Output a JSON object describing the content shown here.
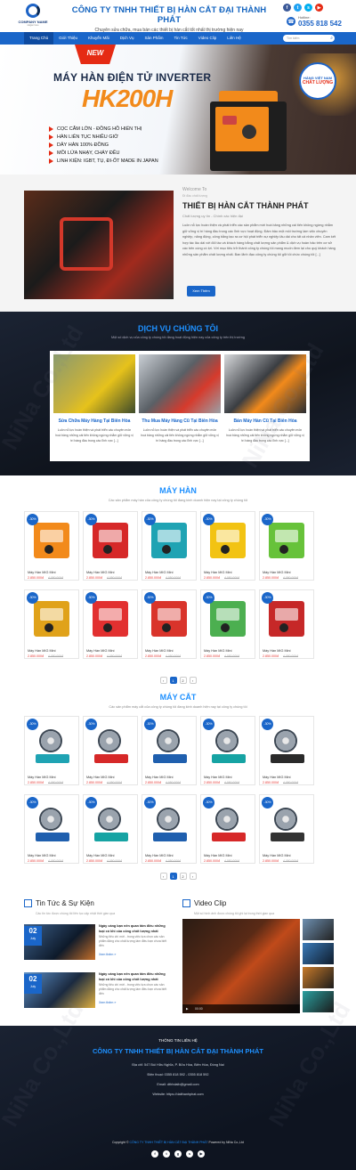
{
  "header": {
    "logo_name": "COMPANY NAME",
    "logo_slogan": "slogan here",
    "company_name": "CÔNG TY TNHH THIẾT BỊ HÀN CẮT ĐẠI THÀNH PHÁT",
    "tagline": "Chuyên sửa chữa, mua bán các thiết bị hàn cắt tốt nhất thị trường hiện nay",
    "socials": [
      {
        "name": "facebook-icon",
        "glyph": "f",
        "color": "#3b5998"
      },
      {
        "name": "twitter-icon",
        "glyph": "t",
        "color": "#1da1f2"
      },
      {
        "name": "skype-icon",
        "glyph": "s",
        "color": "#00aff0"
      },
      {
        "name": "youtube-icon",
        "glyph": "▶",
        "color": "#e52b14"
      }
    ],
    "hotline_label": "Hotline:",
    "hotline": "0355 818 542"
  },
  "nav": {
    "items": [
      "Trang Chủ",
      "Giới Thiệu",
      "Khuyến Mãi",
      "Dịch Vụ",
      "Sản Phẩm",
      "Tin Tức",
      "Video Clip",
      "Liên Hệ"
    ],
    "search_placeholder": "Tìm kiếm"
  },
  "banner": {
    "badge": "NEW",
    "title": "MÁY HÀN ĐIỆN TỬ INVERTER",
    "model": "HK200H",
    "features": [
      "CỌC CẮM LỚN - ĐỒNG HỒ HIỂN THỊ",
      "HÀN LIÊN TỤC NHIỀU GIỜ",
      "DÂY HÀN 100% ĐỒNG",
      "MỒI LỬA NHẠY, CHÁY ĐỀU",
      "LINH KIỆN: IGBT, TỤ, ĐI-ỐT MADE IN JAPAN"
    ],
    "stamp_top": "HÀNG VIỆT NAM",
    "stamp_bottom": "CHẤT LƯỢNG"
  },
  "welcome": {
    "pre": "Welcome To",
    "pre2": "Đi đầu chất lượng",
    "title": "THIẾT BỊ HÀN CẮT THÀNH PHÁT",
    "subtitle": "Chất lượng uy tín - Chính xác hiện đại",
    "paragraph": "Luôn nỗ lực hoàn thiện và phát triển các sản phẩm mới hoá bảng những cái tiến không ngừng nhằm giữ vững vị trí hàng đầu trong các lĩnh vực hoạt động. Đảm bảo một môi trường làm việc chuyên nghiệp, năng động, công bằng tạo ra cơ hội phát triển sự nghiệp lâu dài cho tất cả nhân viên. Cam kết hợp tác lâu dài với đối tác và khách hàng bằng chất lượng sản phẩm & dịch vụ hoàn hảo trên cơ sở các bên cùng có lợi. Với mục tiêu trở thành công ty chúng tôi mang muốn đem lại cho quý khách hàng những sản phẩm chất lượng nhất. Ban lãnh đạo công ty chúng tôi giữ tôi chức chúng tôi [...]",
    "button": "Xem Thêm"
  },
  "services": {
    "title": "DỊCH VỤ CHÚNG TÔI",
    "desc": "Một số dịch vụ của công ty chúng tôi đang hoạt động hiện nay của công ty trên thị trường",
    "items": [
      {
        "name": "Sửa Chữa Máy Hàng Tại Biên Hòa",
        "desc": "Luôn nỗ lực hoàn thiện và phát triển các chuyên môn hoá bảng những cái tiến không ngừng nhằm giữ vững vị trí hàng đầu trong các lĩnh vực [...]"
      },
      {
        "name": "Thu Mua Máy Hàng Cũ Tại Biên Hòa",
        "desc": "Luôn nỗ lực hoàn thiện và phát triển các chuyên môn hoá bảng những cái tiến không ngừng nhằm giữ vững vị trí hàng đầu trong các lĩnh vực [...]"
      },
      {
        "name": "Bán Máy Hàn Cũ Tại Biên Hòa",
        "desc": "Luôn nỗ lực hoàn thiện và phát triển các chuyên môn hoá bảng những cái tiến không ngừng nhằm giữ vững vị trí hàng đầu trong các lĩnh vực [...]"
      }
    ]
  },
  "welders": {
    "title": "MÁY HÀN",
    "desc": "Các sản phẩm máy hàn của công ty chúng tôi đang kinh doanh hiện nay tại công ty chúng tôi",
    "products": [
      {
        "discount": "-30%",
        "name": "Máy Hàn MIG Mini",
        "price": "2.850.000đ",
        "old": "4.050.000đ",
        "color": "#f28a1b"
      },
      {
        "discount": "-30%",
        "name": "Máy Hàn MIG Mini",
        "price": "2.850.000đ",
        "old": "4.050.000đ",
        "color": "#d62828"
      },
      {
        "discount": "-30%",
        "name": "Máy Hàn MIG Mini",
        "price": "2.850.000đ",
        "old": "4.050.000đ",
        "color": "#1fa3b3"
      },
      {
        "discount": "-30%",
        "name": "Máy Hàn MIG Mini",
        "price": "2.850.000đ",
        "old": "4.050.000đ",
        "color": "#f2c313"
      },
      {
        "discount": "-30%",
        "name": "Máy Hàn MIG Mini",
        "price": "2.850.000đ",
        "old": "4.050.000đ",
        "color": "#67c23a"
      },
      {
        "discount": "-30%",
        "name": "Máy Hàn MIG Mini",
        "price": "2.850.000đ",
        "old": "4.050.000đ",
        "color": "#e0a21a"
      },
      {
        "discount": "-30%",
        "name": "Máy Hàn MIG Mini",
        "price": "2.850.000đ",
        "old": "4.050.000đ",
        "color": "#e23030"
      },
      {
        "discount": "-30%",
        "name": "Máy Hàn MIG Mini",
        "price": "2.850.000đ",
        "old": "4.050.000đ",
        "color": "#d9342b"
      },
      {
        "discount": "-30%",
        "name": "Máy Hàn MIG Mini",
        "price": "2.850.000đ",
        "old": "4.050.000đ",
        "color": "#4caf50"
      },
      {
        "discount": "-30%",
        "name": "Máy Hàn MIG Mini",
        "price": "2.850.000đ",
        "old": "4.050.000đ",
        "color": "#c62828"
      }
    ],
    "pages": [
      "‹",
      "1",
      "2",
      "›"
    ]
  },
  "cutters": {
    "title": "MÁY CẮT",
    "desc": "Các sản phẩm máy cắt của công ty chúng tôi đang kinh doanh hiện nay tại công ty chúng tôi",
    "products": [
      {
        "discount": "-30%",
        "name": "Máy Hàn MIG Mini",
        "price": "2.850.000đ",
        "old": "4.050.000đ",
        "color": "#1fa3b3"
      },
      {
        "discount": "-30%",
        "name": "Máy Hàn MIG Mini",
        "price": "2.850.000đ",
        "old": "4.050.000đ",
        "color": "#d62828"
      },
      {
        "discount": "-30%",
        "name": "Máy Hàn MIG Mini",
        "price": "2.850.000đ",
        "old": "4.050.000đ",
        "color": "#1f5fae"
      },
      {
        "discount": "-30%",
        "name": "Máy Hàn MIG Mini",
        "price": "2.850.000đ",
        "old": "4.050.000đ",
        "color": "#16a3a3"
      },
      {
        "discount": "-30%",
        "name": "Máy Hàn MIG Mini",
        "price": "2.850.000đ",
        "old": "4.050.000đ",
        "color": "#2a2a2a"
      },
      {
        "discount": "-30%",
        "name": "Máy Hàn MIG Mini",
        "price": "2.850.000đ",
        "old": "4.050.000đ",
        "color": "#1f5fae"
      },
      {
        "discount": "-30%",
        "name": "Máy Hàn MIG Mini",
        "price": "2.850.000đ",
        "old": "4.050.000đ",
        "color": "#16a3a3"
      },
      {
        "discount": "-30%",
        "name": "Máy Hàn MIG Mini",
        "price": "2.850.000đ",
        "old": "4.050.000đ",
        "color": "#1f5fae"
      },
      {
        "discount": "-30%",
        "name": "Máy Hàn MIG Mini",
        "price": "2.850.000đ",
        "old": "4.050.000đ",
        "color": "#d62828"
      },
      {
        "discount": "-30%",
        "name": "Máy Hàn MIG Mini",
        "price": "2.850.000đ",
        "old": "4.050.000đ",
        "color": "#333333"
      }
    ],
    "pages": [
      "‹",
      "1",
      "2",
      "›"
    ]
  },
  "news": {
    "title": "Tin Tức & Sự Kiện",
    "desc": "Các tin tức được chúng tôi liên tục cập nhật thời gian qua",
    "items": [
      {
        "day": "02",
        "month": "July",
        "title": "Ngày càng bạn nên quan tâm điều những loại có khi của công chốt lượng nhất",
        "excerpt": "Những tiêu chí mới - trong việc lựa chọn các sản phẩm đảng cho chất lượng làm điều bạn chưa biết đến",
        "more": "Xem thêm »"
      },
      {
        "day": "02",
        "month": "July",
        "title": "Ngày càng bạn nên quan tâm điều những loại có khi của công chốt lượng nhất",
        "excerpt": "Những tiêu chí mới - trong việc lựa chọn các sản phẩm đảng cho chất lượng làm điều bạn chưa biết đến",
        "more": "Xem thêm »"
      }
    ]
  },
  "video": {
    "title": "Video Clip",
    "desc": "Một số hình ảnh được chúng tôi ghi lại trong thời gian qua",
    "time": "00:00"
  },
  "footer": {
    "label": "THÔNG TIN LIÊN HỆ",
    "company": "CÔNG TY TNHH THIẾT BỊ HÀN CẮT ĐẠI THÀNH PHÁT",
    "address": "Địa chỉ: 547 Bùi Hữu Nghĩa, P. Bửu Hòa, Biên Hòa, Đồng Nai",
    "phone": "Điện thoại: 0355 818 592 - 0355 818 592",
    "email": "Email: dthhdaib@gmail.com",
    "website": "Website: https://daithanhphat.com",
    "copyright_pre": "Copyright ©",
    "copyright_company": "CÔNG TY TNHH THIẾT BỊ HÀN CẮT ĐẠI THÀNH PHÁT",
    "copyright_post": "Powered by NiNa Co.,Ltd",
    "socials": [
      "f",
      "t",
      "g",
      "s",
      "▶"
    ]
  }
}
